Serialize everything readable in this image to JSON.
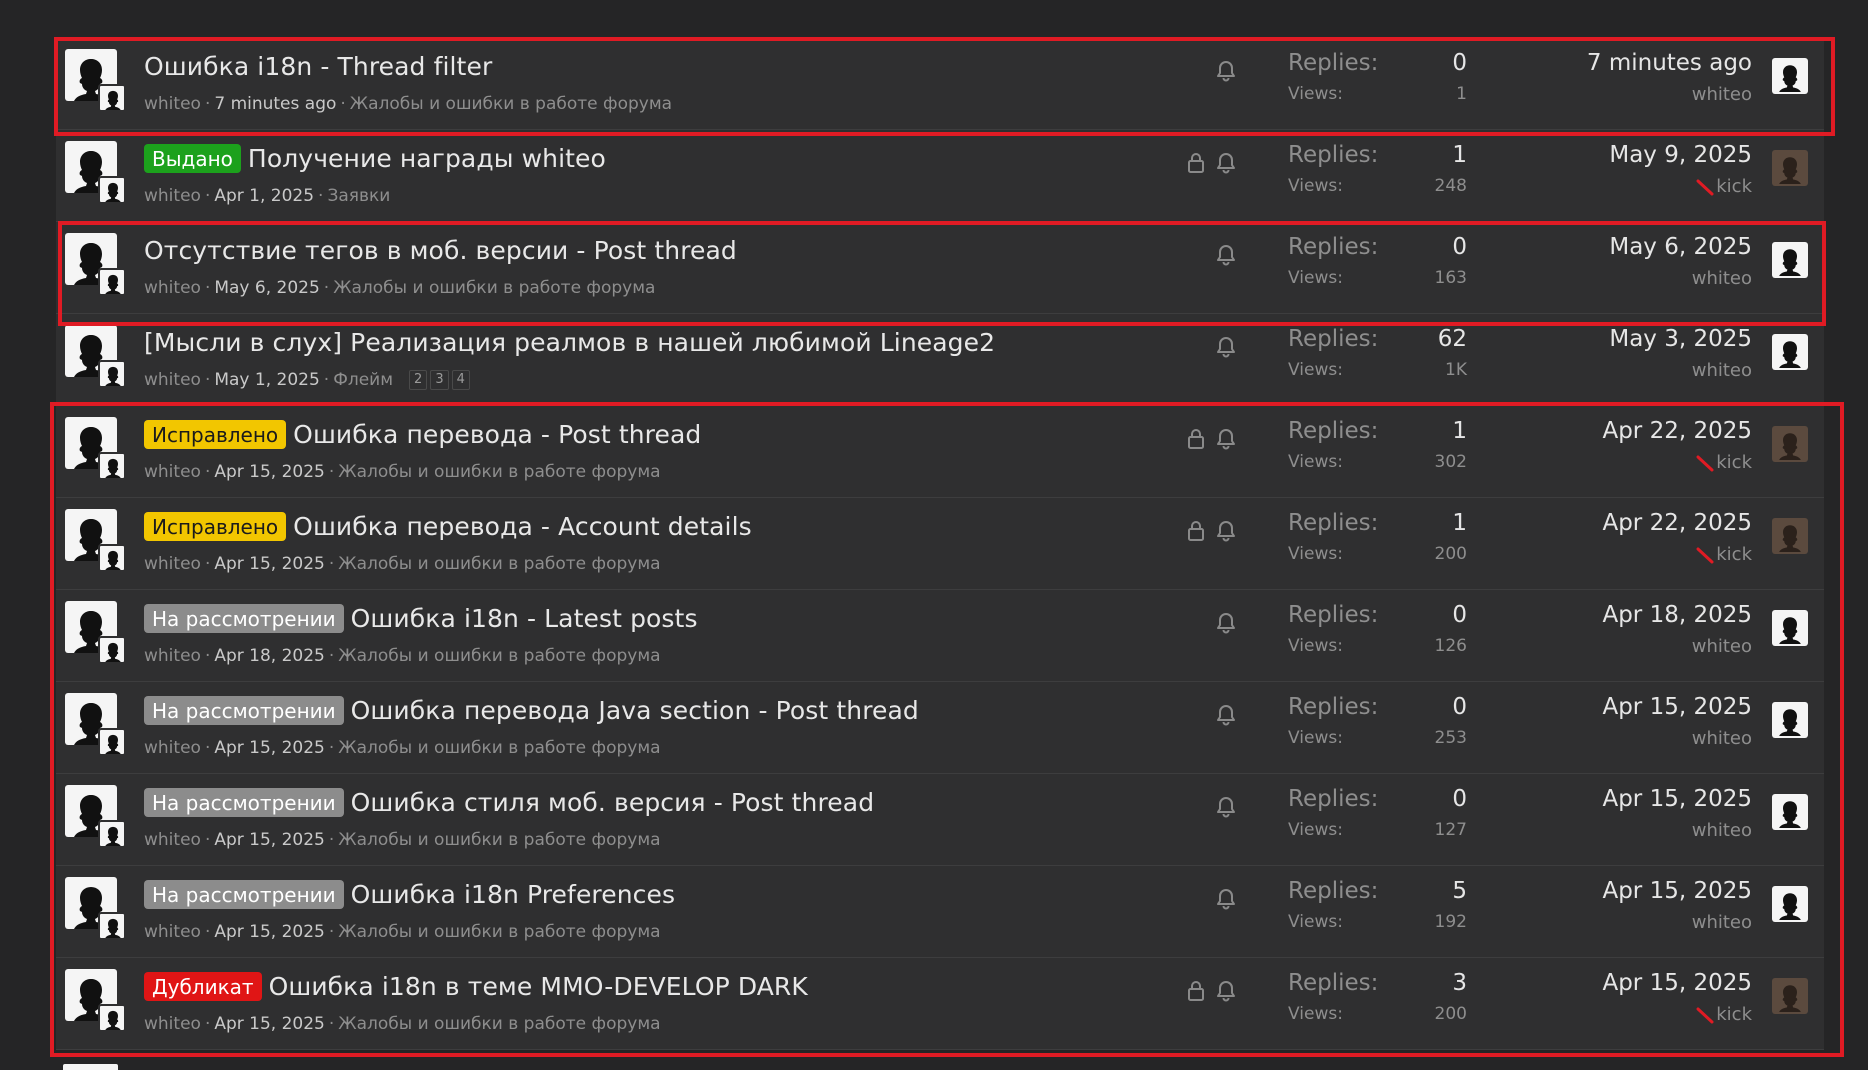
{
  "colors": {
    "background": "#252526",
    "row": "#2f2f30",
    "highlight": "#e01b24",
    "prefix_green": "#1ca11c",
    "prefix_yellow": "#f2c600",
    "prefix_gray": "#8c8c8c",
    "prefix_red": "#e01515"
  },
  "labels": {
    "replies": "Replies:",
    "views": "Views:"
  },
  "icons": {
    "author_avatar": "user-avatar-icon",
    "lock": "lock-icon",
    "watch": "bell-icon",
    "banned": "banned-user-icon"
  },
  "threads": [
    {
      "prefix": "",
      "prefix_color": "",
      "title": "Ошибка i18n - Thread filter",
      "author": "whiteo",
      "date": "7 minutes ago",
      "forum": "Жалобы и ошибки в работе форума",
      "pages": [],
      "locked": false,
      "replies": "0",
      "views": "1",
      "last_date": "7 minutes ago",
      "last_user": "whiteo",
      "last_user_banned": false
    },
    {
      "prefix": "Выдано",
      "prefix_color": "green",
      "title": "Получение награды whiteo",
      "author": "whiteo",
      "date": "Apr 1, 2025",
      "forum": "Заявки",
      "pages": [],
      "locked": true,
      "replies": "1",
      "views": "248",
      "last_date": "May 9, 2025",
      "last_user": "kick",
      "last_user_banned": true
    },
    {
      "prefix": "",
      "prefix_color": "",
      "title": "Отсутствие тегов в моб. версии - Post thread",
      "author": "whiteo",
      "date": "May 6, 2025",
      "forum": "Жалобы и ошибки в работе форума",
      "pages": [],
      "locked": false,
      "replies": "0",
      "views": "163",
      "last_date": "May 6, 2025",
      "last_user": "whiteo",
      "last_user_banned": false
    },
    {
      "prefix": "",
      "prefix_color": "",
      "title": "[Мысли в слух] Реализация реалмов в нашей любимой Lineage2",
      "author": "whiteo",
      "date": "May 1, 2025",
      "forum": "Флейм",
      "pages": [
        "2",
        "3",
        "4"
      ],
      "locked": false,
      "replies": "62",
      "views": "1K",
      "last_date": "May 3, 2025",
      "last_user": "whiteo",
      "last_user_banned": false
    },
    {
      "prefix": "Исправлено",
      "prefix_color": "yellow",
      "title": "Ошибка перевода - Post thread",
      "author": "whiteo",
      "date": "Apr 15, 2025",
      "forum": "Жалобы и ошибки в работе форума",
      "pages": [],
      "locked": true,
      "replies": "1",
      "views": "302",
      "last_date": "Apr 22, 2025",
      "last_user": "kick",
      "last_user_banned": true
    },
    {
      "prefix": "Исправлено",
      "prefix_color": "yellow",
      "title": "Ошибка перевода - Account details",
      "author": "whiteo",
      "date": "Apr 15, 2025",
      "forum": "Жалобы и ошибки в работе форума",
      "pages": [],
      "locked": true,
      "replies": "1",
      "views": "200",
      "last_date": "Apr 22, 2025",
      "last_user": "kick",
      "last_user_banned": true
    },
    {
      "prefix": "На рассмотрении",
      "prefix_color": "gray",
      "title": "Ошибка i18n - Latest posts",
      "author": "whiteo",
      "date": "Apr 18, 2025",
      "forum": "Жалобы и ошибки в работе форума",
      "pages": [],
      "locked": false,
      "replies": "0",
      "views": "126",
      "last_date": "Apr 18, 2025",
      "last_user": "whiteo",
      "last_user_banned": false
    },
    {
      "prefix": "На рассмотрении",
      "prefix_color": "gray",
      "title": "Ошибка перевода Java section - Post thread",
      "author": "whiteo",
      "date": "Apr 15, 2025",
      "forum": "Жалобы и ошибки в работе форума",
      "pages": [],
      "locked": false,
      "replies": "0",
      "views": "253",
      "last_date": "Apr 15, 2025",
      "last_user": "whiteo",
      "last_user_banned": false
    },
    {
      "prefix": "На рассмотрении",
      "prefix_color": "gray",
      "title": "Ошибка стиля моб. версия - Post thread",
      "author": "whiteo",
      "date": "Apr 15, 2025",
      "forum": "Жалобы и ошибки в работе форума",
      "pages": [],
      "locked": false,
      "replies": "0",
      "views": "127",
      "last_date": "Apr 15, 2025",
      "last_user": "whiteo",
      "last_user_banned": false
    },
    {
      "prefix": "На рассмотрении",
      "prefix_color": "gray",
      "title": "Ошибка i18n Preferences",
      "author": "whiteo",
      "date": "Apr 15, 2025",
      "forum": "Жалобы и ошибки в работе форума",
      "pages": [],
      "locked": false,
      "replies": "5",
      "views": "192",
      "last_date": "Apr 15, 2025",
      "last_user": "whiteo",
      "last_user_banned": false
    },
    {
      "prefix": "Дубликат",
      "prefix_color": "red",
      "title": "Ошибка i18n в теме MMO-DEVELOP DARK",
      "author": "whiteo",
      "date": "Apr 15, 2025",
      "forum": "Жалобы и ошибки в работе форума",
      "pages": [],
      "locked": true,
      "replies": "3",
      "views": "200",
      "last_date": "Apr 15, 2025",
      "last_user": "kick",
      "last_user_banned": true
    }
  ]
}
